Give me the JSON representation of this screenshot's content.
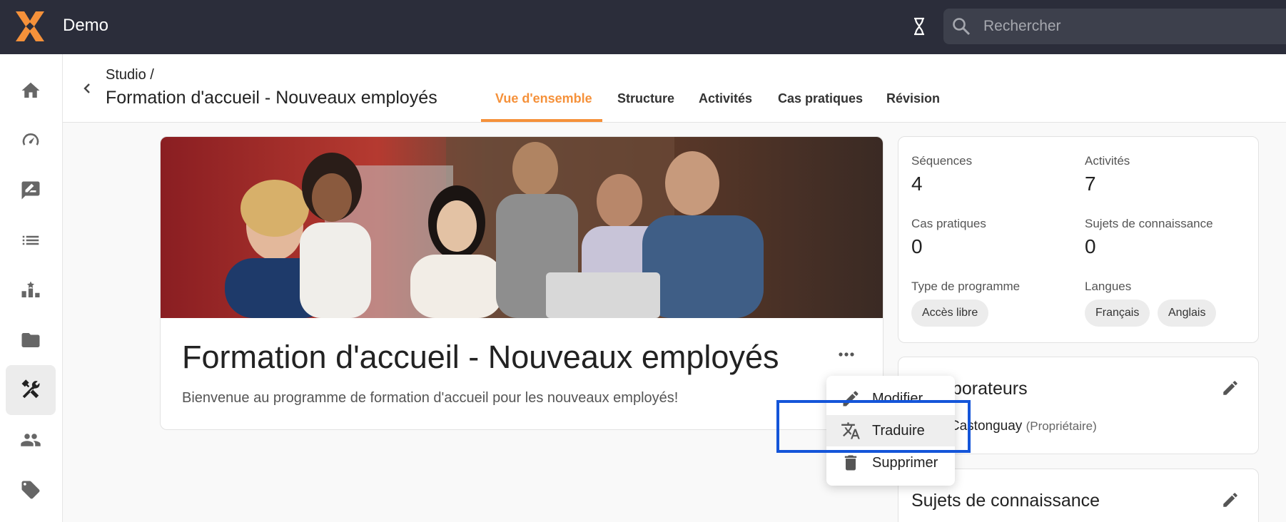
{
  "app": {
    "name": "Demo"
  },
  "search": {
    "placeholder": "Rechercher"
  },
  "sidebar": {
    "items": [
      {
        "name": "home-icon"
      },
      {
        "name": "dashboard-icon"
      },
      {
        "name": "rate-review-icon"
      },
      {
        "name": "list-icon"
      },
      {
        "name": "leaderboard-icon"
      },
      {
        "name": "folder-icon"
      },
      {
        "name": "tools-icon",
        "active": true
      },
      {
        "name": "people-icon"
      },
      {
        "name": "tag-icon"
      }
    ]
  },
  "header": {
    "breadcrumb": "Studio /",
    "title": "Formation d'accueil - Nouveaux employés",
    "tabs": [
      {
        "label": "Vue d'ensemble",
        "active": true
      },
      {
        "label": "Structure"
      },
      {
        "label": "Activités"
      },
      {
        "label": "Cas pratiques"
      },
      {
        "label": "Révision"
      }
    ]
  },
  "program": {
    "title": "Formation d'accueil - Nouveaux employés",
    "description": "Bienvenue au programme de formation d'accueil pour les nouveaux employés!"
  },
  "stats": {
    "sequences_label": "Séquences",
    "sequences_value": "4",
    "activities_label": "Activités",
    "activities_value": "7",
    "cases_label": "Cas pratiques",
    "cases_value": "0",
    "topics_label": "Sujets de connaissance",
    "topics_value": "0",
    "type_label": "Type de programme",
    "type_value": "Accès libre",
    "languages_label": "Langues",
    "languages": [
      "Français",
      "Anglais"
    ]
  },
  "collaborators": {
    "title": "Collaborateurs",
    "name": "Paule Castonguay",
    "role": "(Propriétaire)"
  },
  "topics_card": {
    "title": "Sujets de connaissance"
  },
  "menu": {
    "items": [
      {
        "label": "Modifier",
        "icon": "pencil-icon"
      },
      {
        "label": "Traduire",
        "icon": "translate-icon",
        "hover": true
      },
      {
        "label": "Supprimer",
        "icon": "trash-icon"
      }
    ]
  },
  "colors": {
    "accent": "#f5913a",
    "topbar": "#2b2d3a",
    "highlight": "#1455d9"
  }
}
